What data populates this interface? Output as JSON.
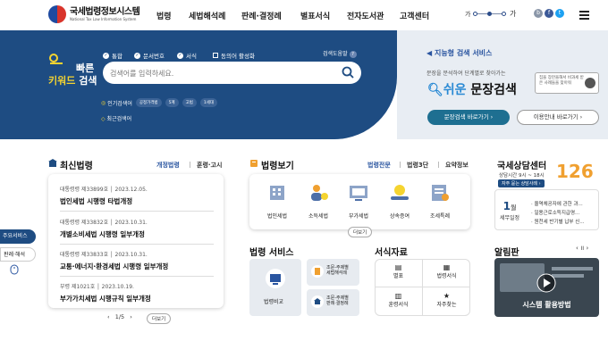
{
  "header": {
    "logo_ko": "국세법령정보시스템",
    "logo_en": "National Tax Law Information System",
    "nav": [
      "법령",
      "세법해석례",
      "판례·결정례",
      "별표서식",
      "전자도서관",
      "고객센터"
    ],
    "font_small": "가",
    "font_large": "가"
  },
  "hero": {
    "title_a": "빠른",
    "title_b": "키워드",
    "title_c": "검색",
    "options": [
      "통합",
      "문서번호",
      "서식",
      "동의어 활성화"
    ],
    "search_placeholder": "검색어를 입력하세요.",
    "guide": "검색도움말",
    "popular_label": "인기검색어",
    "popular_tags": [
      "공정가격법",
      "5계",
      "고법",
      "1세대"
    ],
    "recent_label": "최근검색어"
  },
  "smart": {
    "title": "지능형 검색 서비스",
    "desc": "문장을 분석하여 단계별로 찾아가는",
    "big_a": "쉬운",
    "big_b": "문장검색",
    "mini_text": "집을 장만을해서 비과세 받은 사례들을 찾아줘",
    "btn_go": "문장검색 바로가기 ›",
    "btn_guide": "이용안내 바로가기 ›"
  },
  "side": {
    "main_service": "주요서비스",
    "precedent": "판례·해석"
  },
  "latest": {
    "title": "최신법령",
    "tab_active": "개정법령",
    "tab_other": "훈령·고시",
    "items": [
      {
        "meta": "대통령령 제33899호 │ 2023.12.05.",
        "title": "법인세법 시행령 타법개정"
      },
      {
        "meta": "대통령령 제33832호 │ 2023.10.31.",
        "title": "개별소비세법 시행령 일부개정"
      },
      {
        "meta": "대통령령 제33833호 │ 2023.10.31.",
        "title": "교통·에너지·환경세법 시행령 일부개정"
      },
      {
        "meta": "부령 제1021호 │ 2023.10.19.",
        "title": "부가가치세법 시행규칙 일부개정"
      }
    ],
    "page": "1/5",
    "more": "더보기"
  },
  "laws": {
    "title": "법령보기",
    "tabs": [
      "법령전문",
      "법령3단",
      "요약정보"
    ],
    "items": [
      "법인세법",
      "소득세법",
      "부가세법",
      "상속증여",
      "조세특례"
    ],
    "more": "더보기"
  },
  "service": {
    "title": "법령 서비스",
    "compare": "법령비교",
    "lookup1_a": "조문-주제별",
    "lookup1_b": "세법해석례",
    "lookup2_a": "조문-주제별",
    "lookup2_b": "판례·결정례"
  },
  "materials": {
    "title": "서식자료",
    "items": [
      "별표",
      "법령서식",
      "훈령서식",
      "자주찾는"
    ]
  },
  "consult": {
    "title": "국세상담센터",
    "hours": "상담시간 9시 ~ 18시",
    "link": "자주 묻는 상담사례 ›",
    "phone": "126",
    "month": "1",
    "month_unit": "월",
    "month_label": "세무일정",
    "bullets": [
      "· 올역체공자에 관한 과...",
      "· 일용근로소득지급명...",
      "· 원천세 반기별 납부 신..."
    ]
  },
  "alarm": {
    "title": "알림판",
    "caption": "시스템 활용방법"
  }
}
